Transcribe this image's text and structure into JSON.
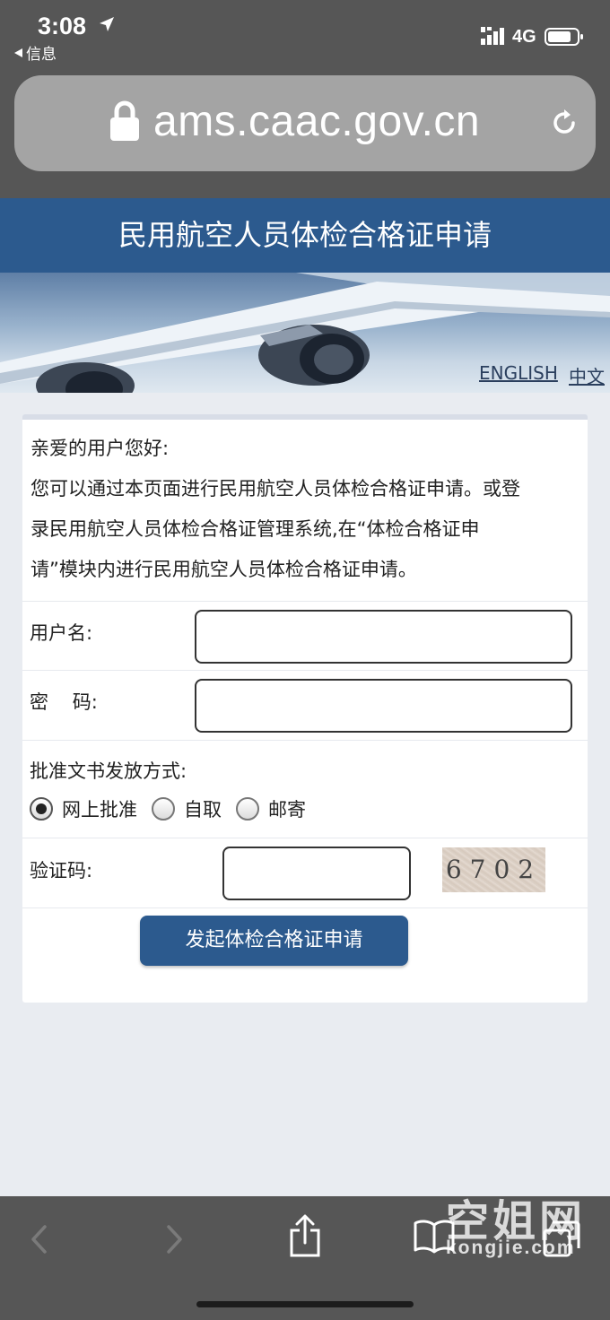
{
  "status_bar": {
    "time": "3:08",
    "back_label": "信息",
    "network": "4G"
  },
  "browser": {
    "url": "ams.caac.gov.cn"
  },
  "page": {
    "title": "民用航空人员体检合格证申请",
    "lang_english": "ENGLISH",
    "lang_chinese": "中文"
  },
  "intro": {
    "greeting": "亲爱的用户您好:",
    "line1": "您可以通过本页面进行民用航空人员体检合格证申请。或登",
    "line2": "录民用航空人员体检合格证管理系统,在“体检合格证申",
    "line3": "请”模块内进行民用航空人员体检合格证申请。"
  },
  "form": {
    "username_label": "用户名:",
    "username_value": "",
    "password_label": "密    码:",
    "password_value": "",
    "delivery_label": "批准文书发放方式:",
    "delivery_options": [
      {
        "label": "网上批准",
        "selected": true
      },
      {
        "label": "自取",
        "selected": false
      },
      {
        "label": "邮寄",
        "selected": false
      }
    ],
    "captcha_label": "验证码:",
    "captcha_value": "",
    "captcha_image_text": "6702",
    "submit_label": "发起体检合格证申请"
  },
  "watermark": {
    "text": "空姐网",
    "sub": "kongjie.com"
  },
  "colors": {
    "brand_blue": "#2c5a8e",
    "chrome_gray": "#565656",
    "page_bg": "#e9ecf1"
  }
}
